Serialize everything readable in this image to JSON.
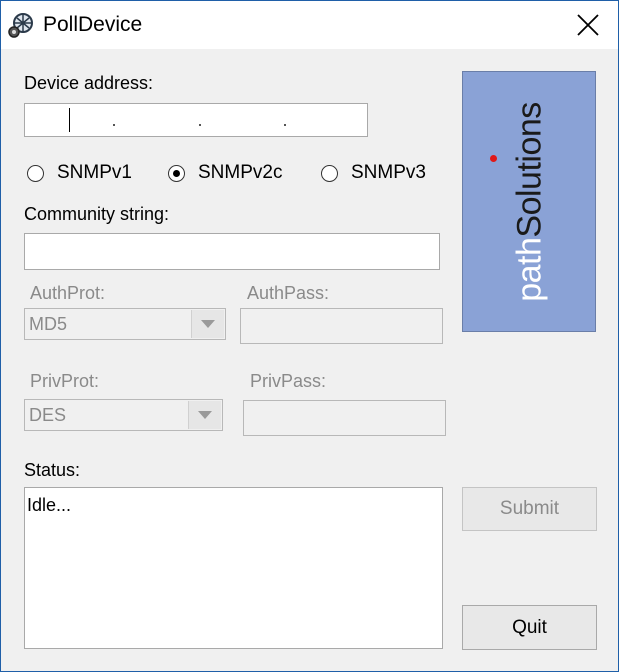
{
  "window": {
    "title": "PollDevice"
  },
  "device_address": {
    "label": "Device address:",
    "value": ""
  },
  "snmp_versions": [
    {
      "label": "SNMPv1",
      "selected": false
    },
    {
      "label": "SNMPv2c",
      "selected": true
    },
    {
      "label": "SNMPv3",
      "selected": false
    }
  ],
  "community": {
    "label": "Community string:",
    "value": ""
  },
  "auth": {
    "prot_label": "AuthProt:",
    "prot_value": "MD5",
    "pass_label": "AuthPass:",
    "pass_value": ""
  },
  "priv": {
    "prot_label": "PrivProt:",
    "prot_value": "DES",
    "pass_label": "PrivPass:",
    "pass_value": ""
  },
  "status": {
    "label": "Status:",
    "text": "Idle..."
  },
  "buttons": {
    "submit": "Submit",
    "quit": "Quit"
  },
  "logo": {
    "part1": "path",
    "part2": "Solutions",
    "mark": "."
  },
  "colors": {
    "logo_bg": "#8aa2d6",
    "logo_dot": "#e01818",
    "window_border": "#1f5fa8"
  }
}
